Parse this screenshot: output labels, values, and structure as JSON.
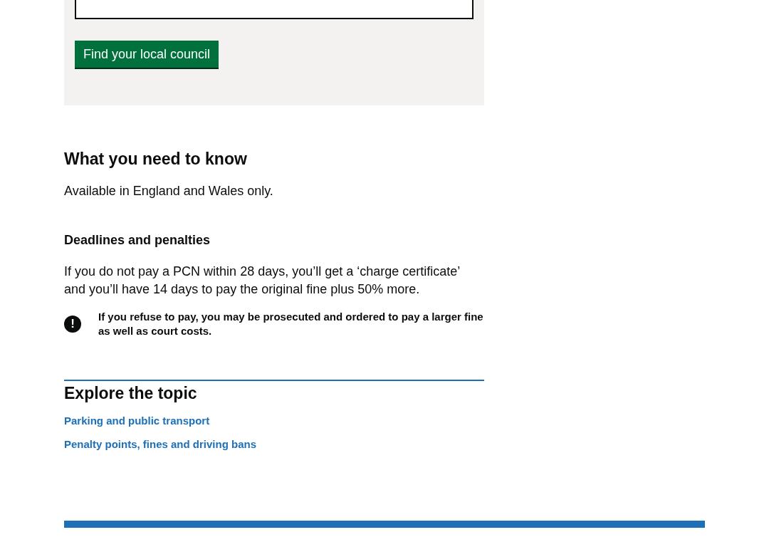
{
  "finder": {
    "button": "Find your local council"
  },
  "sections": [
    {
      "heading": "What you need to know",
      "paragraphs": [
        "Available in England and Wales only."
      ]
    },
    {
      "subheading": "Deadlines and penalties",
      "paragraphs": [
        "If you do not pay a PCN within 28 days, you’ll get a ‘charge certificate’ and you’ll have 14 days to pay the original fine plus 50% more."
      ]
    }
  ],
  "warning": {
    "icon": "!",
    "text": "If you refuse to pay, you may be prosecuted and ordered to pay a larger fine as well as court costs."
  },
  "explore": {
    "heading": "Explore the topic",
    "links": [
      "Parking and public transport",
      "Penalty points, fines and driving bans"
    ]
  }
}
